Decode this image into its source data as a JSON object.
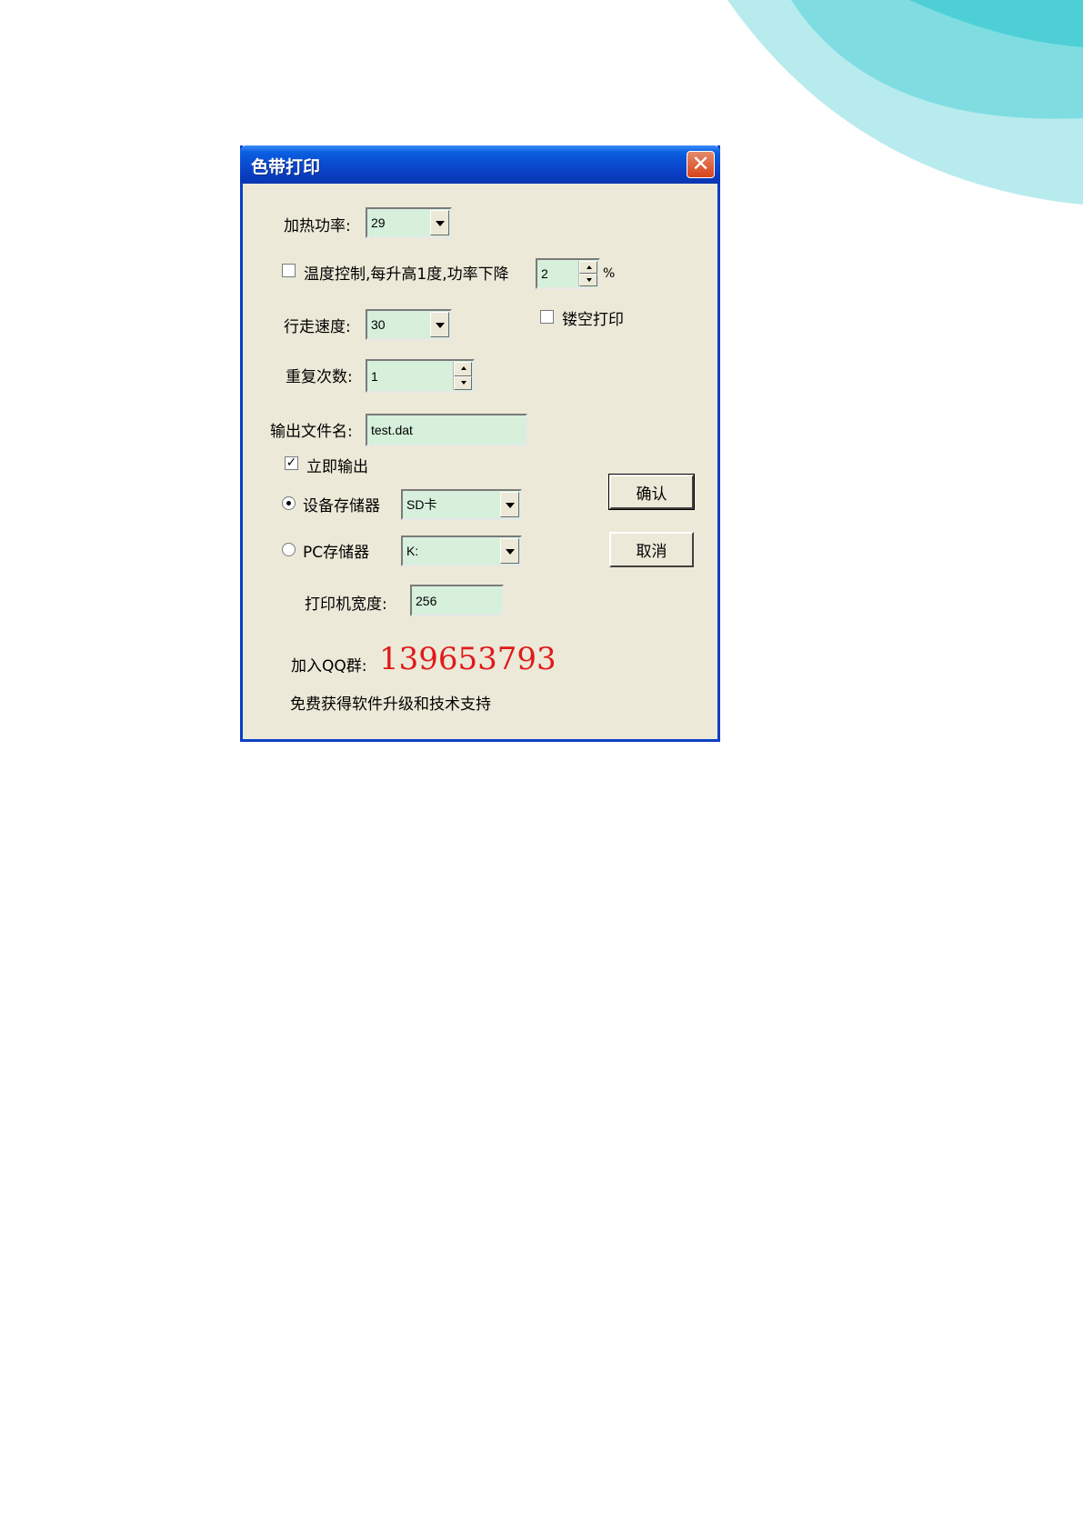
{
  "dialog": {
    "title": "色带打印",
    "close_glyph": "✕",
    "heat_power": {
      "label": "加热功率:",
      "value": "29"
    },
    "temp_control": {
      "label": "温度控制,每升高1度,功率下降",
      "checked": false,
      "value": "2",
      "unit": "%"
    },
    "walk_speed": {
      "label": "行走速度:",
      "value": "30"
    },
    "hollow_print": {
      "label": "镂空打印",
      "checked": false
    },
    "repeat_count": {
      "label": "重复次数:",
      "value": "1"
    },
    "output_file": {
      "label": "输出文件名:",
      "value": "test.dat"
    },
    "output_now": {
      "label": "立即输出",
      "checked": true,
      "check_glyph": "✓"
    },
    "device_storage": {
      "label": "设备存储器",
      "selected": true,
      "value": "SD卡"
    },
    "pc_storage": {
      "label": "PC存储器",
      "selected": false,
      "value": "K:"
    },
    "printer_width": {
      "label": "打印机宽度:",
      "value": "256"
    },
    "confirm_label": "确认",
    "cancel_label": "取消",
    "qq": {
      "label": "加入QQ群:",
      "number": "139653793"
    },
    "support_text": "免费获得软件升级和技术支持"
  },
  "colors": {
    "dialog_bg": "#ece9d8",
    "field_bg": "#d6f0db",
    "title_blue": "#0a3fc5",
    "qq_red": "#e01a1a",
    "deco_teal_dark": "#4ecfd6",
    "deco_teal_light": "#a9e6ea"
  }
}
